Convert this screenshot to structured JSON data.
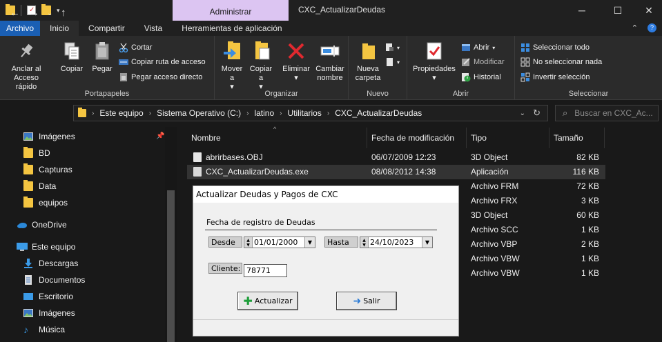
{
  "window": {
    "title": "CXC_ActualizarDeudas",
    "context_tab": "Administrar",
    "controls": {
      "minimize": "─",
      "maximize": "☐",
      "close": "✕"
    }
  },
  "ribbon_tabs": [
    "Archivo",
    "Inicio",
    "Compartir",
    "Vista",
    "Herramientas de aplicación"
  ],
  "ribbon": {
    "portapapeles": {
      "label": "Portapapeles",
      "anclar": "Anclar al Acceso rápido",
      "copiar": "Copiar",
      "pegar": "Pegar",
      "cortar": "Cortar",
      "copiar_ruta": "Copiar ruta de acceso",
      "pegar_acceso": "Pegar acceso directo"
    },
    "organizar": {
      "label": "Organizar",
      "mover_a": "Mover a",
      "copiar_a": "Copiar a",
      "eliminar": "Eliminar",
      "cambiar_nombre": "Cambiar nombre"
    },
    "nuevo": {
      "label": "Nuevo",
      "nueva_carpeta": "Nueva carpeta"
    },
    "abrir": {
      "label": "Abrir",
      "propiedades": "Propiedades",
      "abrir": "Abrir",
      "modificar": "Modificar",
      "historial": "Historial"
    },
    "seleccionar": {
      "label": "Seleccionar",
      "todo": "Seleccionar todo",
      "nada": "No seleccionar nada",
      "invertir": "Invertir selección"
    }
  },
  "address": {
    "breadcrumbs": [
      "Este equipo",
      "Sistema Operativo (C:)",
      "latino",
      "Utilitarios",
      "CXC_ActualizarDeudas"
    ],
    "search_placeholder": "Buscar en CXC_Ac..."
  },
  "sidebar": {
    "items": [
      {
        "label": "Imágenes",
        "icon": "images-icon"
      },
      {
        "label": "BD",
        "icon": "folder-icon"
      },
      {
        "label": "Capturas",
        "icon": "folder-icon"
      },
      {
        "label": "Data",
        "icon": "folder-icon"
      },
      {
        "label": "equipos",
        "icon": "folder-icon"
      },
      {
        "label": "OneDrive",
        "icon": "cloud-icon"
      },
      {
        "label": "Este equipo",
        "icon": "computer-icon"
      },
      {
        "label": "Descargas",
        "icon": "download-icon"
      },
      {
        "label": "Documentos",
        "icon": "document-icon"
      },
      {
        "label": "Escritorio",
        "icon": "desktop-icon"
      },
      {
        "label": "Imágenes",
        "icon": "images-icon"
      },
      {
        "label": "Música",
        "icon": "music-icon"
      }
    ]
  },
  "columns": {
    "name": "Nombre",
    "date": "Fecha de modificación",
    "type": "Tipo",
    "size": "Tamaño"
  },
  "files": [
    {
      "name": "abrirbases.OBJ",
      "date": "06/07/2009 12:23",
      "type": "3D Object",
      "size": "82 KB"
    },
    {
      "name": "CXC_ActualizarDeudas.exe",
      "date": "08/08/2012 14:38",
      "type": "Aplicación",
      "size": "116 KB"
    },
    {
      "name": "",
      "date": "",
      "type": "Archivo FRM",
      "size": "72 KB"
    },
    {
      "name": "",
      "date": "",
      "type": "Archivo FRX",
      "size": "3 KB"
    },
    {
      "name": "",
      "date": "",
      "type": "3D Object",
      "size": "60 KB"
    },
    {
      "name": "",
      "date": "",
      "type": "Archivo SCC",
      "size": "1 KB"
    },
    {
      "name": "",
      "date": "",
      "type": "Archivo VBP",
      "size": "2 KB"
    },
    {
      "name": "",
      "date": "",
      "type": "Archivo VBW",
      "size": "1 KB"
    },
    {
      "name": "",
      "date": "",
      "type": "Archivo VBW",
      "size": "1 KB"
    }
  ],
  "dialog": {
    "title": "Actualizar Deudas y Pagos de CXC",
    "group_label": "Fecha de registro de Deudas",
    "desde_label": "Desde",
    "desde_value": "01/01/2000",
    "hasta_label": "Hasta",
    "hasta_value": "24/10/2023",
    "cliente_label": "Cliente:",
    "cliente_value": "78771",
    "actualizar": "Actualizar",
    "salir": "Salir"
  }
}
